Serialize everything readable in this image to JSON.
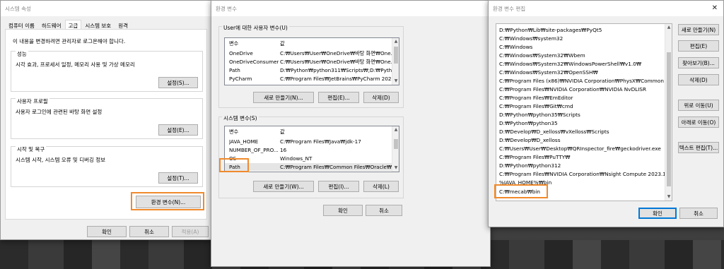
{
  "sysprops": {
    "title": "시스템 속성",
    "tabs": [
      "컴퓨터 이름",
      "하드웨어",
      "고급",
      "시스템 보호",
      "원격"
    ],
    "admin_note": "이 내용을 변경하려면 관리자로 로그온해야 합니다.",
    "perf_title": "성능",
    "perf_desc": "시각 효과, 프로세서 일정, 메모리 사용 및 가상 메모리",
    "perf_btn": "설정(S)...",
    "profile_title": "사용자 프로필",
    "profile_desc": "사용자 로그인에 관련된 바탕 화면 설정",
    "profile_btn": "설정(E)...",
    "startup_title": "시작 및 복구",
    "startup_desc": "시스템 시작, 시스템 오류 및 디버깅 정보",
    "startup_btn": "설정(T)...",
    "env_btn": "환경 변수(N)...",
    "ok": "확인",
    "cancel": "취소",
    "apply": "적용(A)"
  },
  "envvars": {
    "title": "환경 변수",
    "user_group": "User에 대한 사용자 변수(U)",
    "col_var": "변수",
    "col_val": "값",
    "user_rows": [
      {
        "name": "OneDrive",
        "value": "C:₩Users₩User₩OneDrive₩바탕 화면₩One..."
      },
      {
        "name": "OneDriveConsumer",
        "value": "C:₩Users₩User₩OneDrive₩바탕 화면₩One..."
      },
      {
        "name": "Path",
        "value": "D:₩Python₩python311₩Scripts₩;D:₩Pyth..."
      },
      {
        "name": "PyCharm",
        "value": "C:₩Program Files₩JetBrains₩PyCharm 202..."
      }
    ],
    "user_new": "새로 만들기(N)...",
    "user_edit": "편집(E)...",
    "user_delete": "삭제(D)",
    "sys_group": "시스템 변수(S)",
    "sys_rows": [
      {
        "name": "JAVA_HOME",
        "value": "C:₩Program Files₩Java₩jdk-17"
      },
      {
        "name": "NUMBER_OF_PRO...",
        "value": "16"
      },
      {
        "name": "OS",
        "value": "Windows_NT"
      },
      {
        "name": "Path",
        "value": "C:₩Program Files₩Common Files₩Oracle₩..."
      }
    ],
    "sys_new": "새로 만들기(W)...",
    "sys_edit": "편집(I)...",
    "sys_delete": "삭제(L)",
    "ok": "확인",
    "cancel": "취소"
  },
  "editenv": {
    "title": "환경 변수 편집",
    "items": [
      "D:₩Python₩Lib₩site-packages₩PyQt5",
      "C:₩Windows₩system32",
      "C:₩Windows",
      "C:₩Windows₩System32₩Wbem",
      "C:₩Windows₩System32₩WindowsPowerShell₩v1.0₩",
      "C:₩Windows₩System32₩OpenSSH₩",
      "C:₩Program Files (x86)₩NVIDIA Corporation₩PhysX₩Common",
      "C:₩Program Files₩NVIDIA Corporation₩NVIDIA NvDLISR",
      "C:₩Program Files₩EmEditor",
      "C:₩Program Files₩Git₩cmd",
      "D:₩Python₩python35₩Scripts",
      "D:₩Python₩python35",
      "D:₩Develop₩D_xelloss₩vXelloss₩Scripts",
      "D:₩Develop₩D_xelloss",
      "C:₩Users₩User₩Desktop₩QRInspector_fire₩geckodriver.exe",
      "C:₩Program Files₩PuTTY₩",
      "D:₩Python₩python312",
      "C:₩Program Files₩NVIDIA Corporation₩Nsight Compute 2023.1....",
      "%JAVA_HOME%₩bin",
      "C:₩mecab₩bin"
    ],
    "btn_new": "새로 만들기(N)",
    "btn_edit": "편집(E)",
    "btn_browse": "찾아보기(B)...",
    "btn_delete": "삭제(D)",
    "btn_up": "위로 이동(U)",
    "btn_down": "아래로 이동(O)",
    "btn_text": "텍스트 편집(T)...",
    "ok": "확인",
    "cancel": "취소"
  },
  "close_glyph": "✕",
  "accent_highlight": "#f08a2c"
}
